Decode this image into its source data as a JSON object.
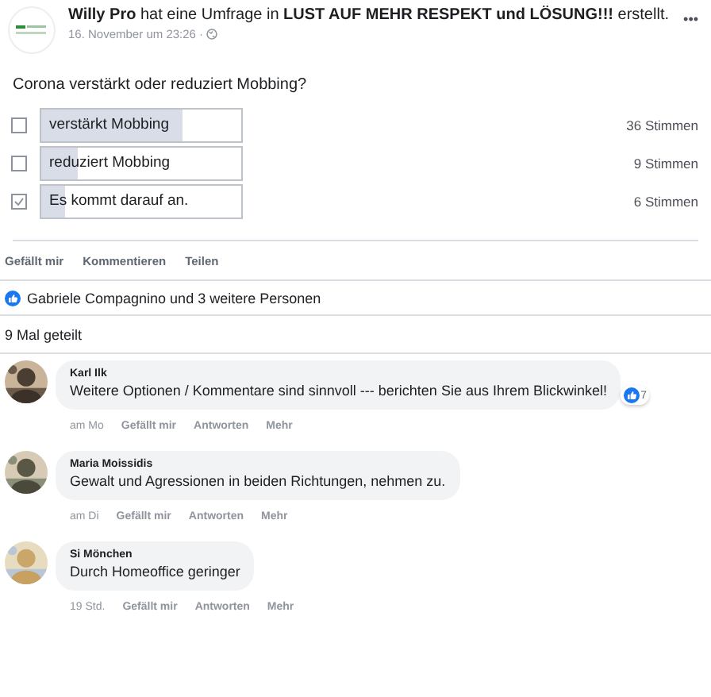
{
  "post": {
    "title": "**Willy Pro** hat eine Umfrage in **LUST AUF MEHR RESPEKT und LÖSUNG!!!** erstellt.",
    "time": "16. November um 23:26 ·",
    "more": "•••"
  },
  "poll": {
    "question": "Corona verstärkt oder reduziert Mobbing?",
    "options": [
      {
        "label": "verstärkt Mobbing",
        "checked": false,
        "level": 0.71,
        "votes": "36 Stimmen"
      },
      {
        "label": "reduziert Mobbing",
        "checked": false,
        "level": 0.18,
        "votes": "9 Stimmen"
      },
      {
        "label": "Es kommt darauf an.",
        "checked": true,
        "level": 0.12,
        "votes": "6 Stimmen"
      }
    ]
  },
  "actions": [
    "Gefällt mir",
    "Kommentieren",
    "Teilen"
  ],
  "likes": "Gabriele Compagnino und 3 weitere Personen",
  "shares": "9 Mal geteilt",
  "comments": [
    {
      "name": "Karl Ilk",
      "text": "Weitere Optionen / Kommentare sind sinnvoll --- berichten Sie aus Ihrem Blickwinkel!",
      "reactions": "7",
      "time": "am Mo",
      "actions": [
        "Gefällt mir",
        "Antworten",
        "Mehr"
      ]
    },
    {
      "name": "Maria Moissidis",
      "text": "Gewalt und Agressionen in beiden Richtungen, nehmen zu.",
      "time": "am Di",
      "actions": [
        "Gefällt mir",
        "Antworten",
        "Mehr"
      ]
    },
    {
      "name": "Si Mönchen",
      "text": "Durch Homeoffice geringer",
      "time": "19 Std.",
      "actions": [
        "Gefällt mir",
        "Antworten",
        "Mehr"
      ]
    }
  ]
}
